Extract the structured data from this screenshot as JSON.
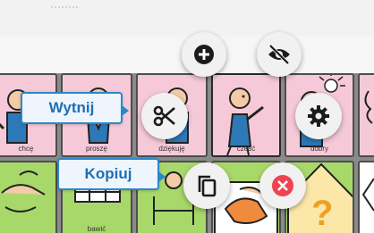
{
  "toolbar": {
    "add_icon": "plus-circle-icon",
    "hide_icon": "eye-off-icon"
  },
  "board": {
    "row1": [
      {
        "label": "chcę"
      },
      {
        "label": "proszę"
      },
      {
        "label": "dziękuję"
      },
      {
        "label": "cześć"
      },
      {
        "label": "dobry"
      },
      {
        "label": ""
      }
    ],
    "row2": [
      {
        "label": ""
      },
      {
        "label": "bawić"
      },
      {
        "label": ""
      },
      {
        "label": ""
      },
      {
        "label": ""
      },
      {
        "label": ""
      }
    ]
  },
  "context_menu": {
    "cut_label": "Wytnij",
    "copy_label": "Kopiuj",
    "cut_icon": "scissors-icon",
    "copy_icon": "copy-icon",
    "settings_icon": "gear-icon",
    "close_icon": "close-icon"
  },
  "colors": {
    "pink_cell": "#f6c9d8",
    "green_cell": "#a8d86a",
    "tooltip_border": "#2a88cc",
    "tooltip_text": "#1e6fb5",
    "close_red": "#ef4351"
  }
}
